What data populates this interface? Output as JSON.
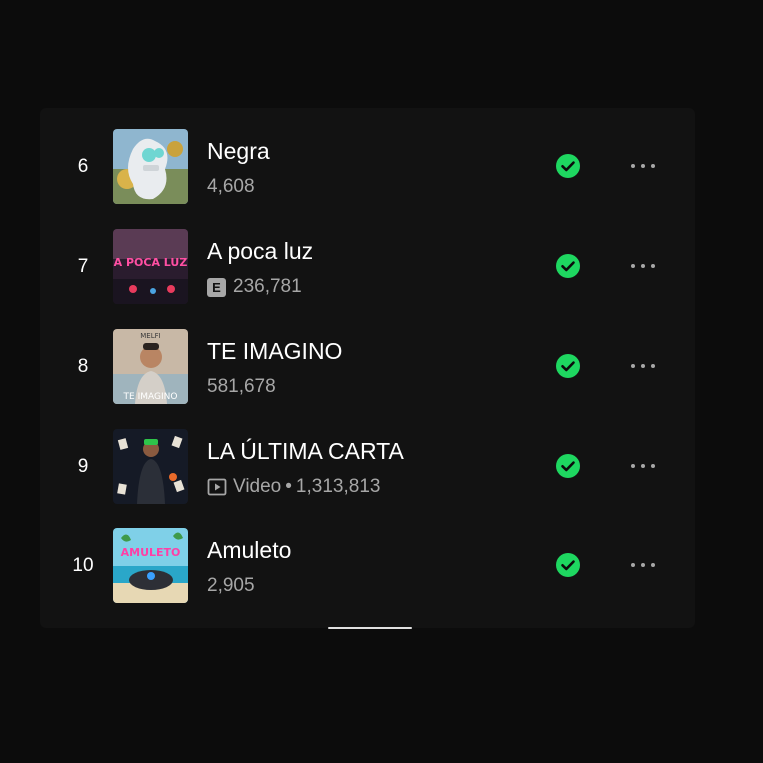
{
  "tracks": [
    {
      "rank": "6",
      "title": "Negra",
      "plays": "4,608",
      "explicit": false,
      "video": false,
      "saved": true,
      "cover_icon": "album-cover-negra"
    },
    {
      "rank": "7",
      "title": "A poca luz",
      "plays": "236,781",
      "explicit": true,
      "explicit_label": "E",
      "video": false,
      "saved": true,
      "cover_icon": "album-cover-a-poca-luz",
      "cover_text": "A POCA LUZ"
    },
    {
      "rank": "8",
      "title": "TE IMAGINO",
      "plays": "581,678",
      "explicit": false,
      "video": false,
      "saved": true,
      "cover_icon": "album-cover-te-imagino",
      "cover_artist": "MELFI",
      "cover_text": "TE IMAGINO"
    },
    {
      "rank": "9",
      "title": "LA ÚLTIMA CARTA",
      "plays": "1,313,813",
      "explicit": false,
      "video": true,
      "video_label": "Video",
      "separator": "•",
      "saved": true,
      "cover_icon": "album-cover-la-ultima-carta"
    },
    {
      "rank": "10",
      "title": "Amuleto",
      "plays": "2,905",
      "explicit": false,
      "video": false,
      "saved": true,
      "cover_icon": "album-cover-amuleto",
      "cover_text": "AMULETO"
    }
  ],
  "colors": {
    "background": "#0c0c0c",
    "panel": "#121212",
    "accent_green": "#1ed760",
    "primary_text": "#ffffff",
    "secondary_text": "#a7a7a7"
  },
  "icons": {
    "saved": "check-circle-icon",
    "more": "more-options-icon",
    "video": "video-play-icon"
  }
}
